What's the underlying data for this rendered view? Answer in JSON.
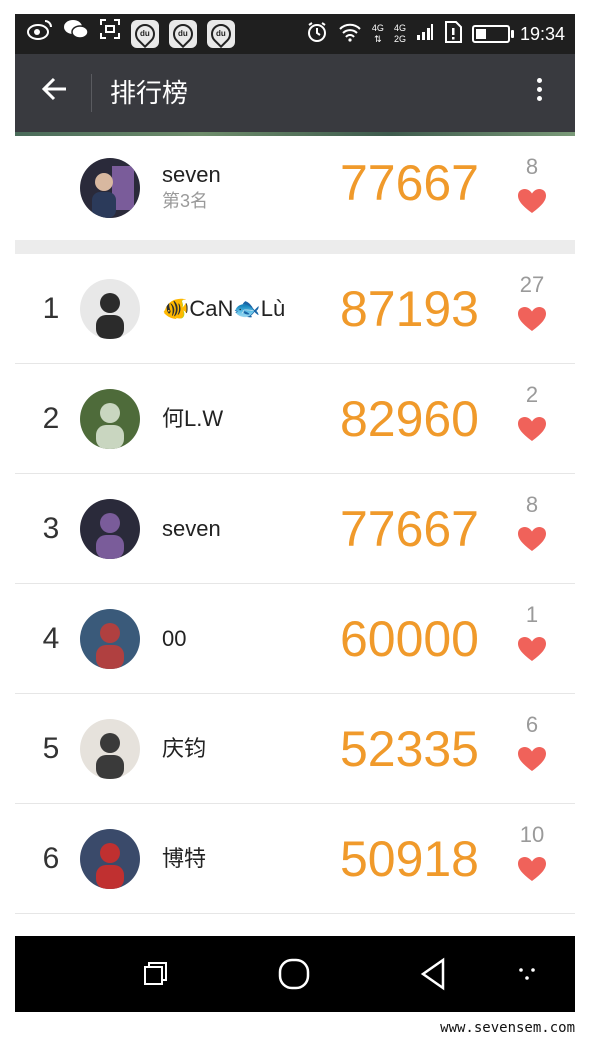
{
  "status_bar": {
    "time": "19:34",
    "net_top": "4G",
    "net_bottom": "2G",
    "icons": [
      "weibo-icon",
      "wechat-icon",
      "scan-icon",
      "du-icon",
      "du-icon",
      "du-icon",
      "alarm-icon",
      "wifi-icon",
      "signal-icon",
      "sim-alert-icon",
      "battery-icon"
    ],
    "du_label": "du"
  },
  "app_bar": {
    "title": "排行榜"
  },
  "my_entry": {
    "name": "seven",
    "rank_text": "第3名",
    "score": "77667",
    "likes": "8"
  },
  "leaderboard": [
    {
      "rank": "1",
      "name": "🐠CaN🐟Lù",
      "score": "87193",
      "likes": "27"
    },
    {
      "rank": "2",
      "name": "何L.W",
      "score": "82960",
      "likes": "2"
    },
    {
      "rank": "3",
      "name": "seven",
      "score": "77667",
      "likes": "8"
    },
    {
      "rank": "4",
      "name": "00",
      "score": "60000",
      "likes": "1"
    },
    {
      "rank": "5",
      "name": "庆钧",
      "score": "52335",
      "likes": "6"
    },
    {
      "rank": "6",
      "name": "博特",
      "score": "50918",
      "likes": "10"
    }
  ],
  "colors": {
    "score": "#f09a2b",
    "heart": "#f0625a",
    "app_bar": "#393a3f"
  },
  "watermark": "www.sevensem.com"
}
